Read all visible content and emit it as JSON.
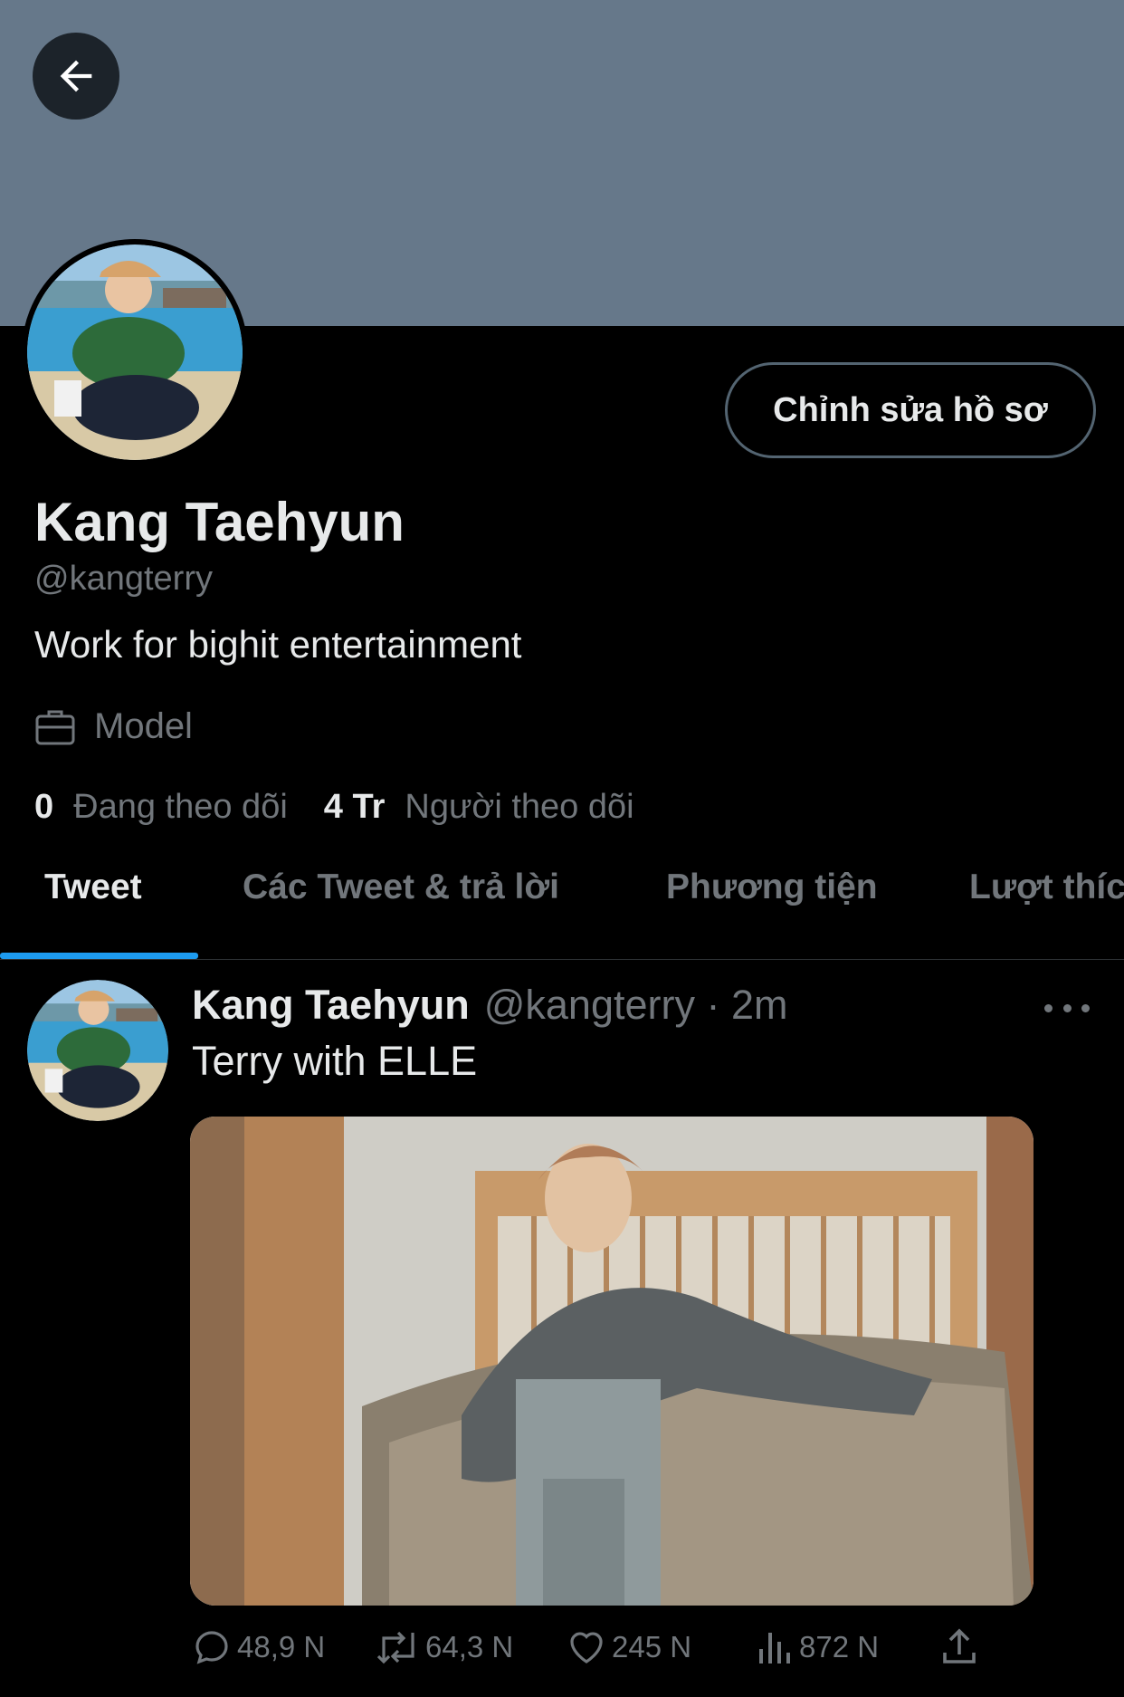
{
  "header": {
    "back_icon": "arrow-left-icon"
  },
  "profile": {
    "display_name": "Kang Taehyun",
    "handle": "@kangterry",
    "bio": "Work for bighit entertainment",
    "profession": "Model",
    "profession_icon": "briefcase-icon",
    "edit_label": "Chỉnh sửa hồ sơ",
    "following_count": "0",
    "following_label": "Đang theo dõi",
    "followers_count": "4 Tr",
    "followers_label": "Người theo dõi"
  },
  "tabs": [
    {
      "label": "Tweet",
      "active": true
    },
    {
      "label": "Các Tweet & trả lời",
      "active": false
    },
    {
      "label": "Phương tiện",
      "active": false
    },
    {
      "label": "Lượt thích",
      "active": false
    }
  ],
  "tweet": {
    "author": "Kang Taehyun",
    "meta": "@kangterry · 2m",
    "text": "Terry with ELLE",
    "replies": "48,9 N",
    "retweets": "64,3 N",
    "likes": "245 N",
    "views": "872 N"
  },
  "colors": {
    "background": "#000000",
    "banner": "#66788a",
    "accent": "#1d9bf0",
    "text_primary": "#e7e9ea",
    "text_secondary": "#71767b"
  }
}
